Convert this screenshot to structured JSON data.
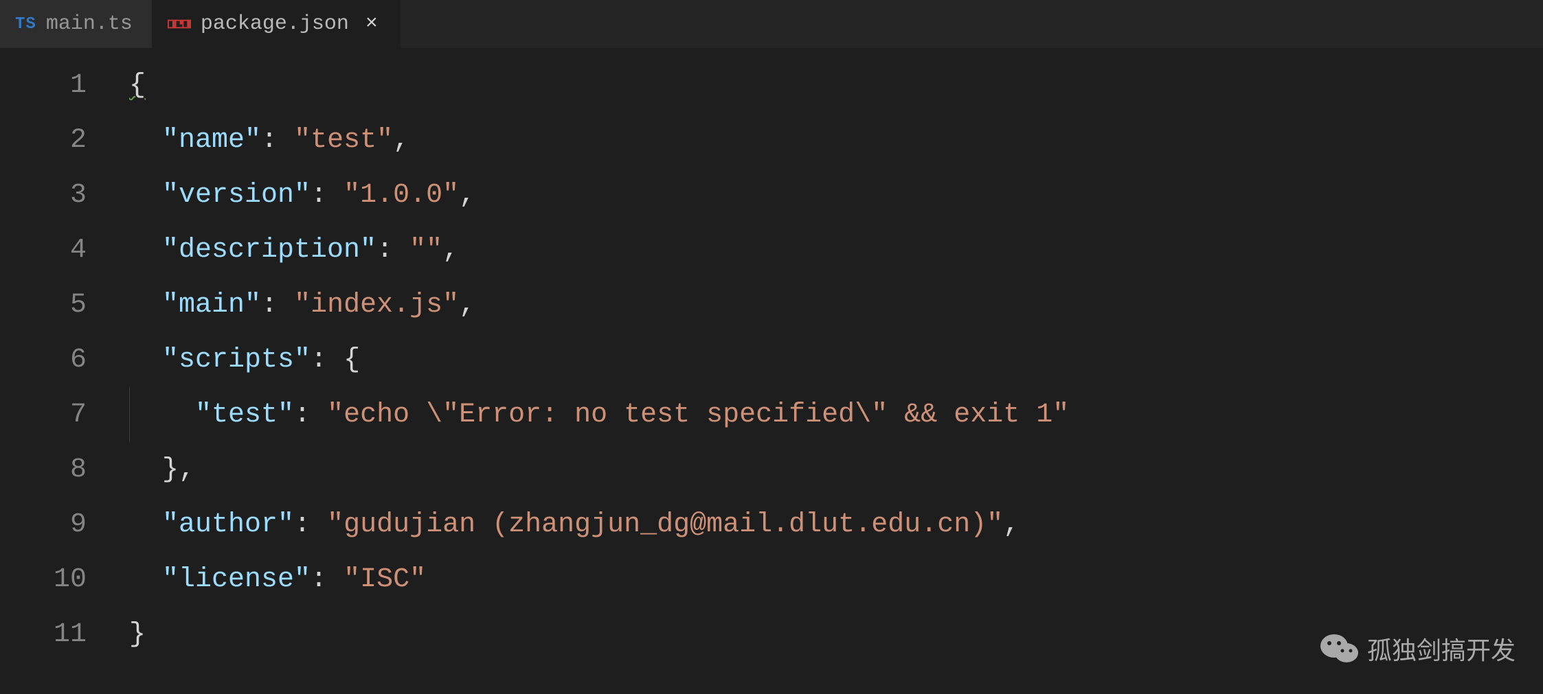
{
  "tabs": [
    {
      "label": "main.ts",
      "icon": "ts",
      "active": false,
      "dirty": false
    },
    {
      "label": "package.json",
      "icon": "npm",
      "active": true,
      "dirty": false
    }
  ],
  "close_glyph": "×",
  "line_numbers": [
    "1",
    "2",
    "3",
    "4",
    "5",
    "6",
    "7",
    "8",
    "9",
    "10",
    "11"
  ],
  "code": {
    "l1_open": "{",
    "l2_key": "\"name\"",
    "l2_val": "\"test\"",
    "l3_key": "\"version\"",
    "l3_val": "\"1.0.0\"",
    "l4_key": "\"description\"",
    "l4_val": "\"\"",
    "l5_key": "\"main\"",
    "l5_val": "\"index.js\"",
    "l6_key": "\"scripts\"",
    "l6_open": "{",
    "l7_key": "\"test\"",
    "l7_val": "\"echo \\\"Error: no test specified\\\" && exit 1\"",
    "l8_close": "}",
    "l9_key": "\"author\"",
    "l9_val": "\"gudujian (zhangjun_dg@mail.dlut.edu.cn)\"",
    "l10_key": "\"license\"",
    "l10_val": "\"ISC\"",
    "l11_close": "}",
    "colon": ":",
    "comma": ",",
    "space": " "
  },
  "watermark": {
    "text": "孤独剑搞开发"
  }
}
